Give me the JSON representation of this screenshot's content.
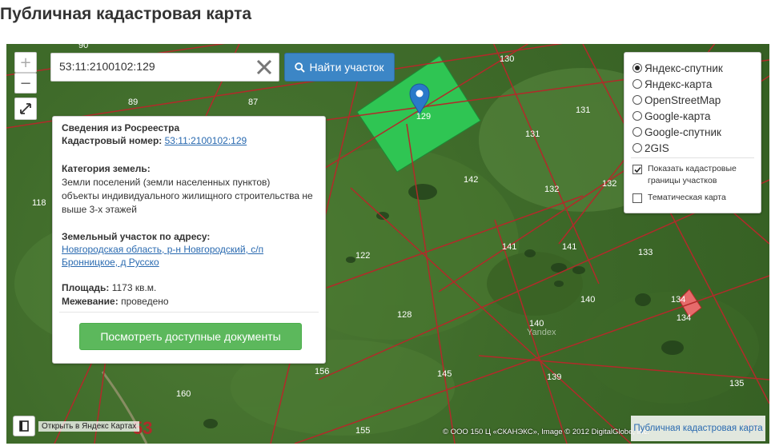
{
  "page": {
    "title": "Публичная кадастровая карта"
  },
  "map": {
    "zoom_in": "+",
    "zoom_out": "−",
    "selected_parcel": "129",
    "marked_parcel": "134",
    "district_number": "53",
    "edge_number": "41",
    "parcel_labels": [
      "90",
      "130",
      "89",
      "87",
      "131",
      "131",
      "142",
      "132",
      "118",
      "132",
      "141",
      "122",
      "141",
      "133",
      "140",
      "128",
      "134",
      "140",
      "156",
      "145",
      "139",
      "135",
      "160",
      "155"
    ],
    "watermark": "Yandex",
    "attribution": "© ООО 150 Ц «СКАНЭКС», Image © 2012 DigitalGlobe, Inc.",
    "colors": {
      "boundary": "#b22a2a",
      "selected_fill": "#2fc553",
      "marked_fill": "#e66b6b",
      "marker": "#2a79c9"
    }
  },
  "search": {
    "value": "53:11:2100102:129",
    "button_label": "Найти участок"
  },
  "info": {
    "heading": "Сведения из Росреестра",
    "cadastral_label": "Кадастровый номер:",
    "cadastral_value": "53:11:2100102:129",
    "category_label": "Категория земель:",
    "category_line1": "Земли поселений (земли населенных пунктов)",
    "category_line2": "объекты индивидуального жилищного строительства не",
    "category_line3": "выше 3-х этажей",
    "address_label": "Земельный участок по адресу:",
    "address_line1": "Новгородская область, р-н Новгородский, с/п",
    "address_line2": "Бронницкое, д Русско",
    "area_label": "Площадь:",
    "area_value": "1173 кв.м.",
    "survey_label": "Межевание:",
    "survey_value": "проведено",
    "docs_button": "Посмотреть доступные документы"
  },
  "layers": {
    "options": [
      "Яндекс-спутник",
      "Яндекс-карта",
      "OpenStreetMap",
      "Google-карта",
      "Google-спутник",
      "2GIS"
    ],
    "selected": "Яндекс-спутник",
    "show_boundaries_line1": "Показать кадастровые",
    "show_boundaries_line2": "границы участков",
    "show_boundaries_checked": true,
    "thematic_map": "Тематическая карта",
    "thematic_map_checked": false
  },
  "footer": {
    "open_yandex": "Открыть в Яндекс Картах",
    "link": "Публичная кадастровая карта"
  }
}
